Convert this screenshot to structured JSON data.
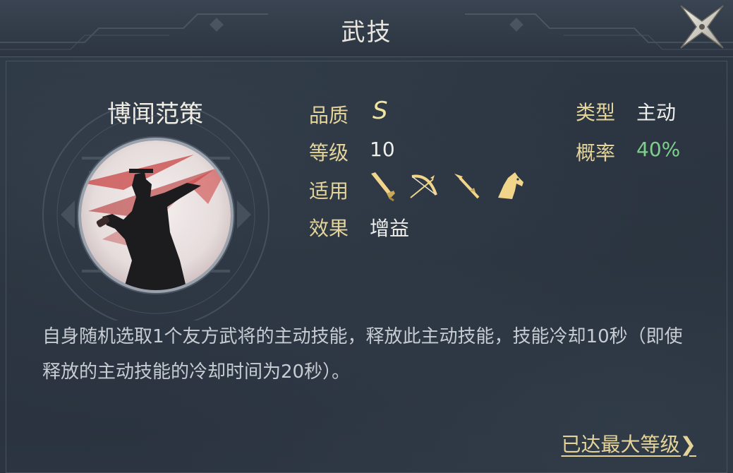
{
  "header": {
    "title": "武技"
  },
  "skill": {
    "name": "博闻范策",
    "quality_label": "品质",
    "quality_value": "S",
    "level_label": "等级",
    "level_value": "10",
    "applicable_label": "适用",
    "effect_label": "效果",
    "effect_value": "增益",
    "type_label": "类型",
    "type_value": "主动",
    "chance_label": "概率",
    "chance_value": "40%",
    "weapons": [
      "sword-icon",
      "bow-icon",
      "spear-icon",
      "horse-icon"
    ],
    "description": "自身随机选取1个友方武将的主动技能，释放此主动技能，技能冷却10秒（即使释放的主动技能的冷却时间为20秒）。"
  },
  "footer": {
    "max_level_label": "已达最大等级"
  },
  "colors": {
    "label_gold": "#e4d49a",
    "chance_green": "#7fcf8c"
  }
}
